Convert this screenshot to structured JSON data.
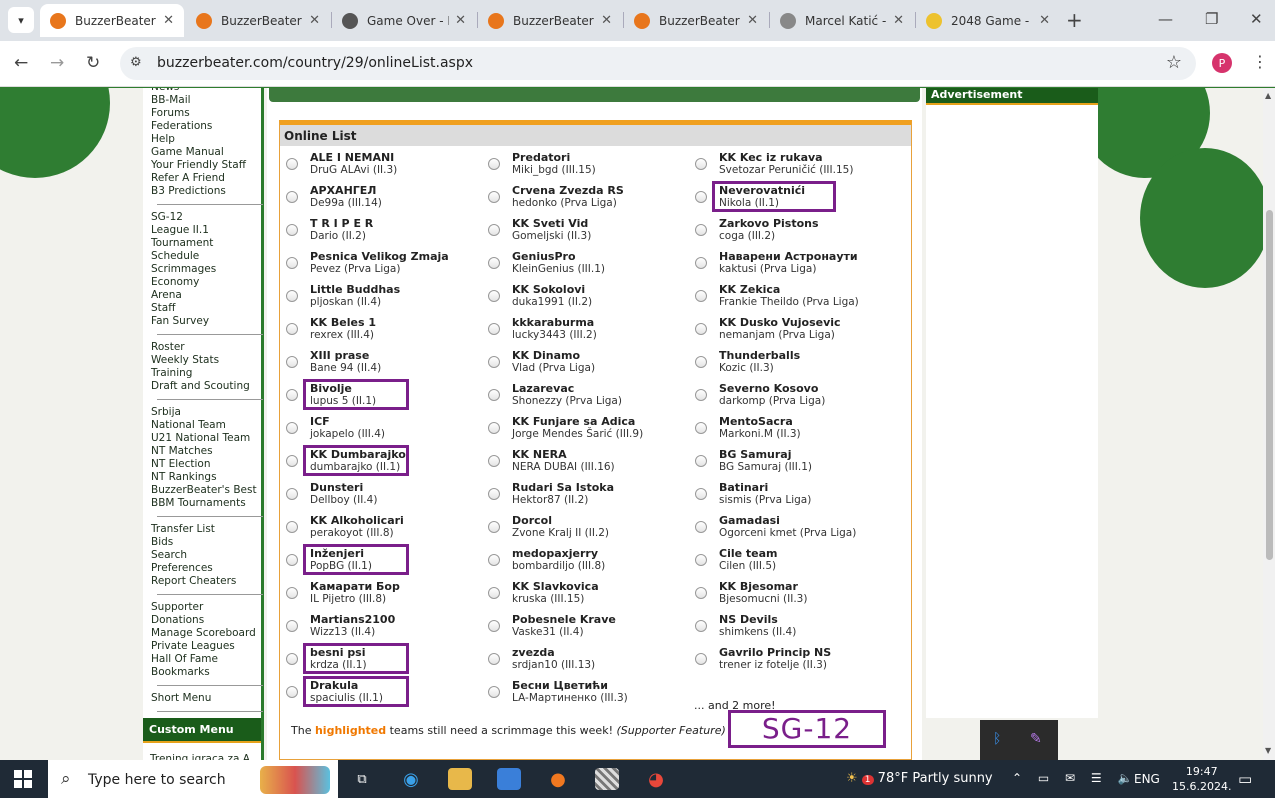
{
  "browser": {
    "tabs": [
      {
        "title": "BuzzerBeater | ",
        "active": true,
        "icon": "basketball-icon",
        "color": "#e8761c"
      },
      {
        "title": "BuzzerBeater | ",
        "active": false,
        "icon": "basketball-icon",
        "color": "#e8761c"
      },
      {
        "title": "Game Over - P",
        "active": false,
        "icon": "clock-icon",
        "color": "#555555"
      },
      {
        "title": "BuzzerBeater | ",
        "active": false,
        "icon": "basketball-icon",
        "color": "#e8761c"
      },
      {
        "title": "BuzzerBeater | ",
        "active": false,
        "icon": "basketball-icon",
        "color": "#e8761c"
      },
      {
        "title": "Marcel Katić - ",
        "active": false,
        "icon": "wave-icon",
        "color": "#888888"
      },
      {
        "title": "2048 Game - ",
        "active": false,
        "icon": "2048-icon",
        "color": "#edc22e"
      }
    ],
    "tab_close": "✕",
    "new_tab": "+",
    "url": "buzzerbeater.com/country/29/onlineList.aspx",
    "profile_initial": "P"
  },
  "left_nav": {
    "groups": [
      [
        "News",
        "BB-Mail",
        "Forums",
        "Federations",
        "Help",
        "Game Manual",
        "Your Friendly Staff",
        "Refer A Friend",
        "B3 Predictions"
      ],
      [
        "SG-12",
        "League II.1",
        "Tournament",
        "Schedule",
        "Scrimmages",
        "Economy",
        "Arena",
        "Staff",
        "Fan Survey"
      ],
      [
        "Roster",
        "Weekly Stats",
        "Training",
        "Draft and Scouting"
      ],
      [
        "Srbija",
        "National Team",
        "U21 National Team",
        "NT Matches",
        "NT Election",
        "NT Rankings",
        "BuzzerBeater's Best",
        "BBM Tournaments"
      ],
      [
        "Transfer List",
        "Bids",
        "Search",
        "Preferences",
        "Report Cheaters"
      ],
      [
        "Supporter",
        "Donations",
        "Manage Scoreboard",
        "Private Leagues",
        "Hall Of Fame",
        "Bookmarks"
      ],
      [
        "Short Menu"
      ]
    ],
    "custom_menu_title": "Custom Menu",
    "custom_menu_items": [
      "Trening igraca za A"
    ]
  },
  "online_list": {
    "title": "Online List",
    "columns": [
      [
        {
          "name": "ALE I NEMANI",
          "owner": "DruG ALAvi (II.3)",
          "highlighted": false
        },
        {
          "name": "АРХАНГЕЛ",
          "owner": "De99a (III.14)",
          "highlighted": false
        },
        {
          "name": "T R I P E R",
          "owner": "Dario (II.2)",
          "highlighted": false
        },
        {
          "name": "Pesnica Velikog Zmaja",
          "owner": "Pevez (Prva Liga)",
          "highlighted": false
        },
        {
          "name": "Little Buddhas",
          "owner": "pljoskan (II.4)",
          "highlighted": false
        },
        {
          "name": "KK Beles 1",
          "owner": "rexrex (III.4)",
          "highlighted": false
        },
        {
          "name": "XIII prase",
          "owner": "Bane 94 (II.4)",
          "highlighted": false
        },
        {
          "name": "Bivolje",
          "owner": "lupus 5 (II.1)",
          "highlighted": true
        },
        {
          "name": "ICF",
          "owner": "jokapelo (III.4)",
          "highlighted": false
        },
        {
          "name": "KK Dumbarajko",
          "owner": "dumbarajko (II.1)",
          "highlighted": true
        },
        {
          "name": "Dunsteri",
          "owner": "Dellboy (II.4)",
          "highlighted": false
        },
        {
          "name": "KK Alkoholicari",
          "owner": "perakoyot (III.8)",
          "highlighted": false
        },
        {
          "name": "Inženjeri",
          "owner": "PopBG (II.1)",
          "highlighted": true
        },
        {
          "name": "Камарати Бор",
          "owner": "IL Pijetro (III.8)",
          "highlighted": false
        },
        {
          "name": "Martians2100",
          "owner": "Wizz13 (II.4)",
          "highlighted": false
        },
        {
          "name": "besni psi",
          "owner": "krdza (II.1)",
          "highlighted": true
        },
        {
          "name": "Drakula",
          "owner": "spaciulis (II.1)",
          "highlighted": true
        }
      ],
      [
        {
          "name": "Predatori",
          "owner": "Miki_bgd (III.15)",
          "highlighted": false
        },
        {
          "name": "Crvena Zvezda RS",
          "owner": "hedonko (Prva Liga)",
          "highlighted": false
        },
        {
          "name": "KK Sveti Vid",
          "owner": "Gomeljski (II.3)",
          "highlighted": false
        },
        {
          "name": "GeniusPro",
          "owner": "KleinGenius (III.1)",
          "highlighted": false
        },
        {
          "name": "KK Sokolovi",
          "owner": "duka1991 (II.2)",
          "highlighted": false
        },
        {
          "name": "kkkaraburma",
          "owner": "lucky3443 (III.2)",
          "highlighted": false
        },
        {
          "name": "KK Dinamo",
          "owner": "Vlad (Prva Liga)",
          "highlighted": false
        },
        {
          "name": "Lazarevac",
          "owner": "Shonezzy (Prva Liga)",
          "highlighted": false
        },
        {
          "name": "KK Funjare sa Adica",
          "owner": "Jorge Mendes Šarić (III.9)",
          "highlighted": false
        },
        {
          "name": "KK NERA",
          "owner": "NERA DUBAI (III.16)",
          "highlighted": false
        },
        {
          "name": "Rudari Sa Istoka",
          "owner": "Hektor87 (II.2)",
          "highlighted": false
        },
        {
          "name": "Dorcol",
          "owner": "Zvone Kralj II (II.2)",
          "highlighted": false
        },
        {
          "name": "medopaxjerry",
          "owner": "bombardiljo (III.8)",
          "highlighted": false
        },
        {
          "name": "KK Slavkovica",
          "owner": "kruska (III.15)",
          "highlighted": false
        },
        {
          "name": "Pobesnele Krave",
          "owner": "Vaske31 (II.4)",
          "highlighted": false
        },
        {
          "name": "zvezda",
          "owner": "srdjan10 (III.13)",
          "highlighted": false
        },
        {
          "name": "Бесни Цветићи",
          "owner": "LA-Мартиненко (III.3)",
          "highlighted": false
        }
      ],
      [
        {
          "name": "KK Kec iz rukava",
          "owner": "Svetozar Peruničić (III.15)",
          "highlighted": false
        },
        {
          "name": "Neverovatnići",
          "owner": "Nikola (II.1)",
          "highlighted": true
        },
        {
          "name": "Zarkovo Pistons",
          "owner": "coga (III.2)",
          "highlighted": false
        },
        {
          "name": "Наварени Астронаути",
          "owner": "kaktusi (Prva Liga)",
          "highlighted": false
        },
        {
          "name": "KK Zekica",
          "owner": "Frankie Theildo (Prva Liga)",
          "highlighted": false
        },
        {
          "name": "KK Dusko Vujosevic",
          "owner": "nemanjam (Prva Liga)",
          "highlighted": false
        },
        {
          "name": "Thunderballs",
          "owner": "Kozic (II.3)",
          "highlighted": false
        },
        {
          "name": "Severno Kosovo",
          "owner": "darkomp (Prva Liga)",
          "highlighted": false
        },
        {
          "name": "MentoSacra",
          "owner": "Markoni.M (II.3)",
          "highlighted": false
        },
        {
          "name": "BG Samuraj",
          "owner": "BG Samuraj (III.1)",
          "highlighted": false
        },
        {
          "name": "Batinari",
          "owner": "sismis (Prva Liga)",
          "highlighted": false
        },
        {
          "name": "Gamadasi",
          "owner": "Ogorceni kmet (Prva Liga)",
          "highlighted": false
        },
        {
          "name": "Cile team",
          "owner": "Cilen (III.5)",
          "highlighted": false
        },
        {
          "name": "KK Bjesomar",
          "owner": "Bjesomucni (II.3)",
          "highlighted": false
        },
        {
          "name": "NS Devils",
          "owner": "shimkens (II.4)",
          "highlighted": false
        },
        {
          "name": "Gavrilo Princip NS",
          "owner": "trener iz fotelje (II.3)",
          "highlighted": false
        }
      ]
    ],
    "more_text": "... and 2 more!",
    "note_prefix": "The ",
    "note_highlight": "highlighted",
    "note_middle": " teams still need a scrimmage this week! ",
    "note_italic": "(Supporter Feature)",
    "annotation": "SG-12"
  },
  "ad": {
    "title": "Advertisement"
  },
  "taskbar": {
    "search_placeholder": "Type here to search",
    "weather_temp": "78°F",
    "weather_text": "Partly sunny",
    "weather_badge": "1",
    "language": "ENG",
    "time": "19:47",
    "date": "15.6.2024."
  },
  "colors": {
    "accent_green": "#1a5c1a",
    "orange": "#f0a020",
    "highlight_box": "#7a1f8a",
    "highlight_text": "#f07800"
  }
}
